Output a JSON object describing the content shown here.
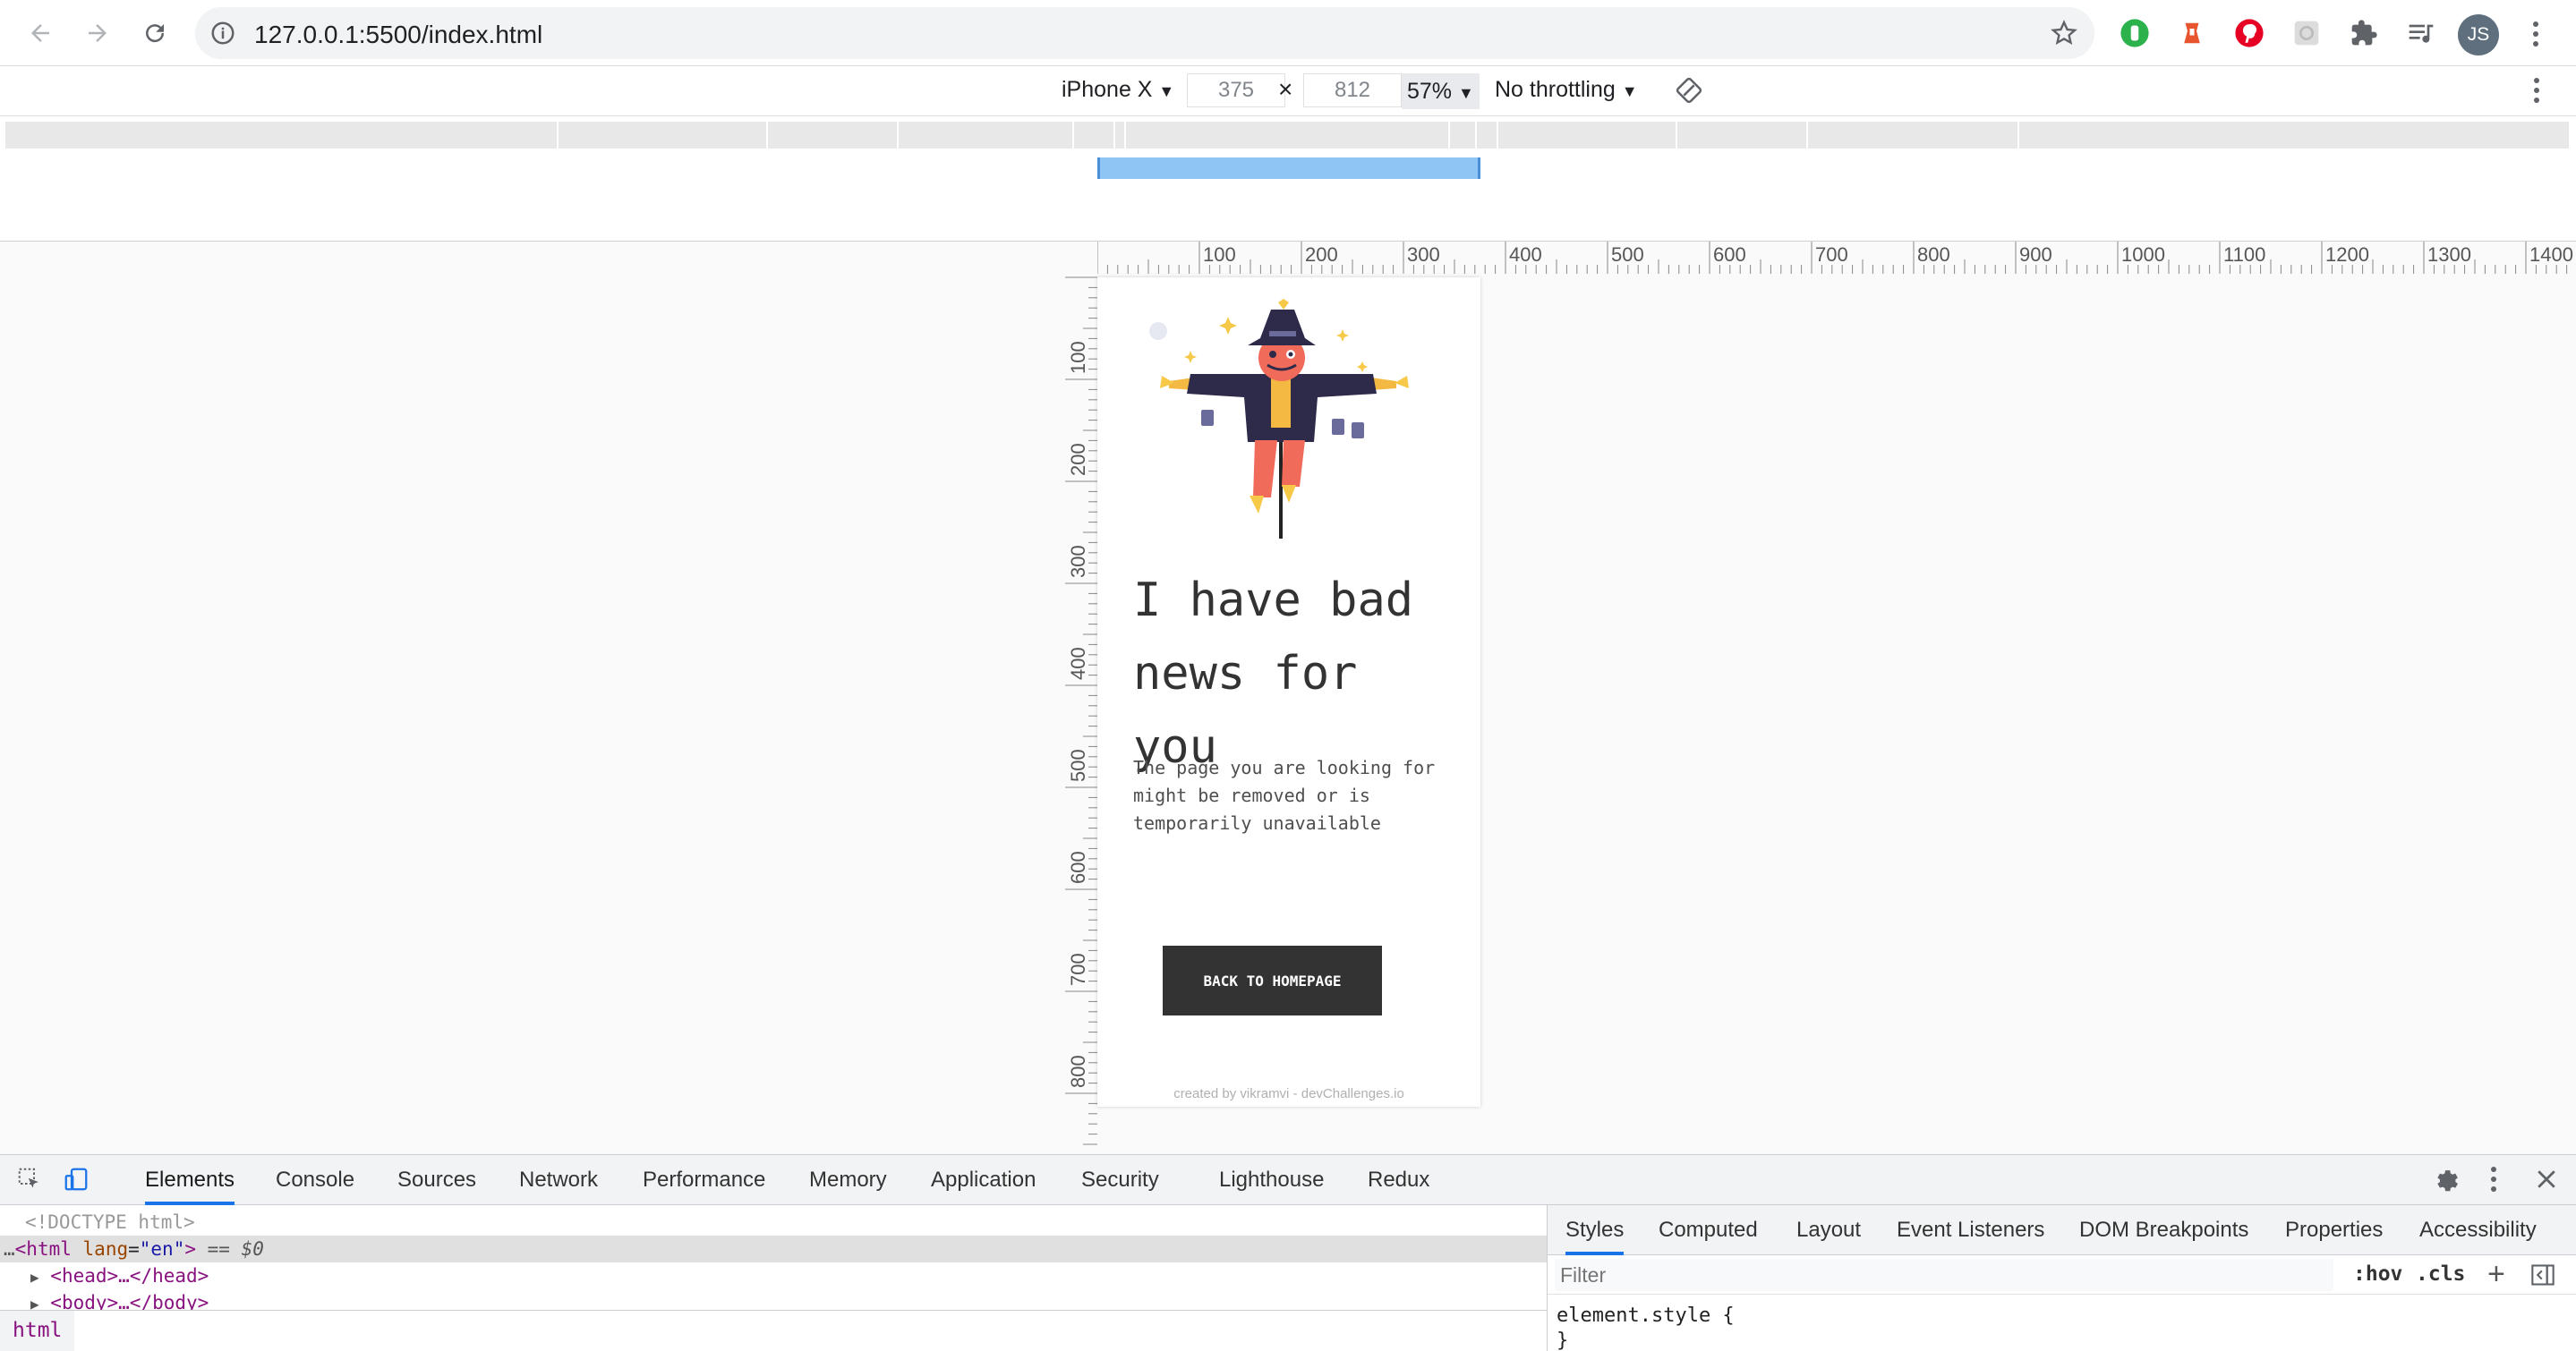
{
  "browser": {
    "url": "127.0.0.1:5500/index.html",
    "avatar_initials": "JS",
    "icons": [
      "back-arrow-icon",
      "forward-arrow-icon",
      "reload-icon",
      "info-icon",
      "star-icon",
      "extension-green-icon",
      "extension-orange-icon",
      "pinterest-icon",
      "extension-gray-icon",
      "puzzle-icon",
      "media-queue-icon",
      "kebab-menu-icon"
    ]
  },
  "device_toolbar": {
    "device": "iPhone X",
    "width": "375",
    "height": "812",
    "times": "×",
    "zoom": "57%",
    "throttling": "No throttling"
  },
  "rulers": {
    "top": [
      "100",
      "200",
      "300",
      "400",
      "500",
      "600",
      "700",
      "800",
      "900",
      "1000",
      "1100",
      "1200",
      "1300",
      "1400"
    ],
    "left": [
      "100",
      "200",
      "300",
      "400",
      "500",
      "600",
      "700",
      "800"
    ]
  },
  "page": {
    "headline": "I have bad news for you",
    "subtext": "The page you are looking for might be removed or is temporarily unavailable",
    "button": "BACK TO HOMEPAGE",
    "credit": "created by vikramvi - devChallenges.io"
  },
  "devtools": {
    "tabs": [
      "Elements",
      "Console",
      "Sources",
      "Network",
      "Performance",
      "Memory",
      "Application",
      "Security",
      "Lighthouse",
      "Redux"
    ],
    "active_tab": "Elements",
    "dom": {
      "doctype": "<!DOCTYPE html>",
      "html_open": "<html",
      "lang_attr": "lang",
      "lang_value": "\"en\"",
      "html_close": ">",
      "selected_marker": "== $0",
      "head": "<head>…</head>",
      "body": "<body>…</body>",
      "ellipsis": "…"
    },
    "breadcrumb": "html",
    "styles_tabs": [
      "Styles",
      "Computed",
      "Layout",
      "Event Listeners",
      "DOM Breakpoints",
      "Properties",
      "Accessibility"
    ],
    "filter_placeholder": "Filter",
    "hov": ":hov",
    "cls": ".cls",
    "plus": "+",
    "element_style_open": "element.style {",
    "element_style_close": "}"
  },
  "colors": {
    "accent": "#1a73e8",
    "button_bg": "#333333",
    "media_query_selected": "#8ec5f5"
  }
}
